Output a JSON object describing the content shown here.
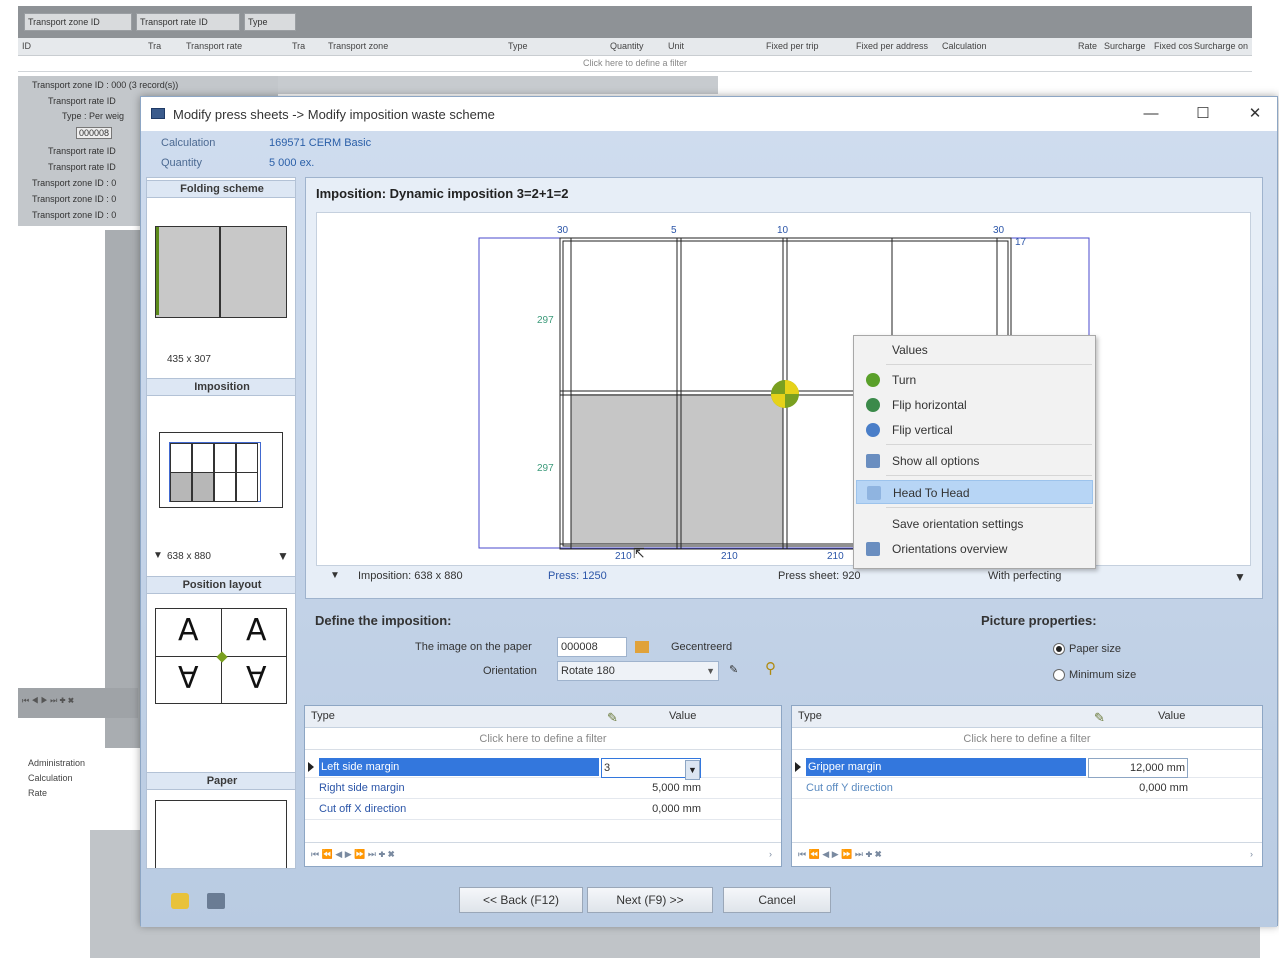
{
  "background": {
    "toolbar_chips": [
      "Transport zone ID",
      "Transport rate ID",
      "Type"
    ],
    "grid_header": [
      "ID",
      "Tra",
      "Transport rate",
      "Tra",
      "Transport zone",
      "Type",
      "Quantity",
      "Unit",
      "Fixed per trip",
      "Fixed per address",
      "Calculation",
      "Rate",
      "Surcharge",
      "Fixed cos",
      "Surcharge on"
    ],
    "filter_hint": "Click here to define a filter",
    "tree": [
      "Transport zone ID : 000 (3 record(s))",
      "Transport rate ID",
      "Type : Per weig",
      "000008",
      "Transport rate ID",
      "Transport rate ID",
      "Transport zone ID : 0",
      "Transport zone ID : 0",
      "Transport zone ID : 0"
    ],
    "admin_list": [
      "Administration",
      "Calculation",
      "Rate"
    ]
  },
  "dialog": {
    "title": "Modify press sheets -> Modify imposition waste scheme",
    "minimize": "—",
    "maximize": "☐",
    "close": "✕",
    "calculation_label": "Calculation",
    "calculation_value": "169571 CERM Basic",
    "quantity_label": "Quantity",
    "quantity_value": "5 000 ex."
  },
  "left_panel": {
    "folding_scheme": "Folding scheme",
    "folding_size": "435 x 307",
    "imposition": "Imposition",
    "imposition_size": "638 x 880",
    "position_layout": "Position layout",
    "glyph": "A",
    "glyph_flipped": "∀",
    "paper": "Paper"
  },
  "imposition": {
    "title": "Imposition:  Dynamic imposition 3=2+1=2",
    "dim_top": [
      "30",
      "5",
      "10",
      "30",
      "17"
    ],
    "dim_left": [
      "297",
      "297"
    ],
    "dim_bottom": [
      "210",
      "210",
      "210"
    ],
    "status_imposition": "Imposition: 638 x 880",
    "status_press": "Press: 1250",
    "status_press_sheet": "Press sheet: 920",
    "status_perfecting": "With perfecting"
  },
  "context_menu": {
    "values": "Values",
    "turn": "Turn",
    "flip_horizontal": "Flip horizontal",
    "flip_vertical": "Flip vertical",
    "show_all_options": "Show all options",
    "head_to_head": "Head To Head",
    "save_orientation": "Save orientation settings",
    "orientations_overview": "Orientations overview"
  },
  "define": {
    "title": "Define the imposition:",
    "image_label": "The image on the paper",
    "image_value": "000008",
    "gecentreerd": "Gecentreerd",
    "orientation_label": "Orientation",
    "orientation_value": "Rotate 180",
    "picture_title": "Picture properties:",
    "paper_size": "Paper size",
    "minimum_size": "Minimum size"
  },
  "grid_left": {
    "col_type": "Type",
    "col_value": "Value",
    "filter": "Click here to define a filter",
    "rows": [
      {
        "type": "Left side margin",
        "value": "3"
      },
      {
        "type": "Right side margin",
        "value": "5,000 mm"
      },
      {
        "type": "Cut off X direction",
        "value": "0,000 mm"
      }
    ]
  },
  "grid_right": {
    "col_type": "Type",
    "col_value": "Value",
    "filter": "Click here to define a filter",
    "rows": [
      {
        "type": "Gripper margin",
        "value": "12,000 mm"
      },
      {
        "type": "Cut off Y direction",
        "value": "0,000 mm"
      }
    ]
  },
  "footer": {
    "back": "<< Back (F12)",
    "next": "Next (F9) >>",
    "cancel": "Cancel"
  },
  "colors": {
    "accent": "#3377dd",
    "dialog_bg": "#cfdcec",
    "highlight": "#b7d5f5"
  }
}
